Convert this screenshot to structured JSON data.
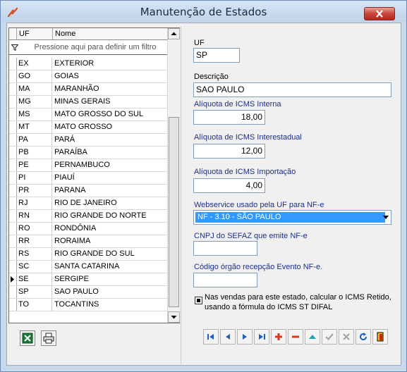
{
  "window": {
    "title": "Manutenção de Estados",
    "accent": "#1c2f8a",
    "selection": "#3399ff"
  },
  "grid": {
    "columns": [
      "UF",
      "Nome"
    ],
    "filter_hint": "Pressione aqui para definir um filtro",
    "current_index": 17,
    "rows": [
      {
        "uf": "EX",
        "nome": "EXTERIOR"
      },
      {
        "uf": "GO",
        "nome": "GOIAS"
      },
      {
        "uf": "MA",
        "nome": "MARANHÃO"
      },
      {
        "uf": "MG",
        "nome": "MINAS GERAIS"
      },
      {
        "uf": "MS",
        "nome": "MATO GROSSO DO SUL"
      },
      {
        "uf": "MT",
        "nome": "MATO GROSSO"
      },
      {
        "uf": "PA",
        "nome": "PARÁ"
      },
      {
        "uf": "PB",
        "nome": "PARAÍBA"
      },
      {
        "uf": "PE",
        "nome": "PERNAMBUCO"
      },
      {
        "uf": "PI",
        "nome": "PIAUÍ"
      },
      {
        "uf": "PR",
        "nome": "PARANA"
      },
      {
        "uf": "RJ",
        "nome": "RIO DE JANEIRO"
      },
      {
        "uf": "RN",
        "nome": "RIO GRANDE DO NORTE"
      },
      {
        "uf": "RO",
        "nome": "RONDÔNIA"
      },
      {
        "uf": "RR",
        "nome": "RORAIMA"
      },
      {
        "uf": "RS",
        "nome": "RIO GRANDE DO SUL"
      },
      {
        "uf": "SC",
        "nome": "SANTA CATARINA"
      },
      {
        "uf": "SE",
        "nome": "SERGIPE"
      },
      {
        "uf": "SP",
        "nome": "SAO PAULO"
      },
      {
        "uf": "TO",
        "nome": "TOCANTINS"
      }
    ]
  },
  "left_toolbar": {
    "icons": [
      "excel-export-icon",
      "print-icon"
    ]
  },
  "form": {
    "uf": {
      "label": "UF",
      "value": "SP"
    },
    "descricao": {
      "label": "Descrição",
      "value": "SAO PAULO"
    },
    "icms_interna": {
      "label": "Alíquota de ICMS Interna",
      "value": "18,00"
    },
    "icms_interestadual": {
      "label": "Alíquota de ICMS Interestadual",
      "value": "12,00"
    },
    "icms_importacao": {
      "label": "Alíquota de ICMS Importação",
      "value": "4,00"
    },
    "webservice": {
      "label": "Webservice usado pela UF para NF-e",
      "value": "NF - 3.10 - SÃO PAULO"
    },
    "cnpj_sefaz": {
      "label": "CNPJ do SEFAZ que emite NF-e",
      "value": ""
    },
    "codigo_orgao": {
      "label": "Código órgão recepção Evento NF-e.",
      "value": ""
    },
    "icms_retido": {
      "checked": true,
      "line1": "Nas vendas para este estado, calcular o ICMS Retido,",
      "line2": "usando a fórmula do ICMS ST DIFAL"
    }
  },
  "navigator": {
    "buttons": [
      "first-icon",
      "prior-icon",
      "next-icon",
      "last-icon",
      "insert-icon",
      "delete-icon",
      "edit-icon",
      "post-icon",
      "cancel-icon",
      "refresh-icon",
      "exit-icon"
    ]
  }
}
